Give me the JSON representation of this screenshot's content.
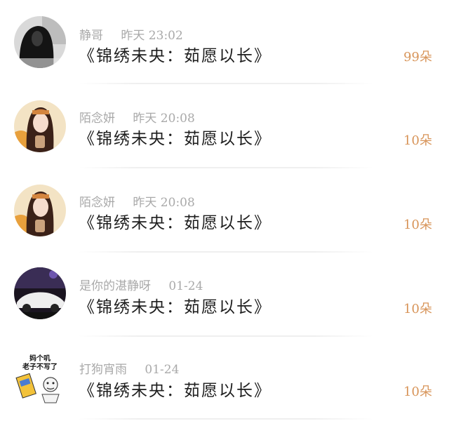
{
  "comments": [
    {
      "name": "静哥",
      "time": "昨天 23:02",
      "title": "《锦绣未央：茹愿以长》",
      "count": "99朵",
      "avatar": "dark-portrait-avatar"
    },
    {
      "name": "陌念妍",
      "time": "昨天 20:08",
      "title": "《锦绣未央：茹愿以长》",
      "count": "10朵",
      "avatar": "cartoon-girl-avatar"
    },
    {
      "name": "陌念妍",
      "time": "昨天 20:08",
      "title": "《锦绣未央：茹愿以长》",
      "count": "10朵",
      "avatar": "cartoon-girl-avatar"
    },
    {
      "name": "是你的湛静呀",
      "time": "01-24",
      "title": "《锦绣未央：茹愿以长》",
      "count": "10朵",
      "avatar": "white-sports-car-avatar"
    },
    {
      "name": "打狗宵雨",
      "time": "01-24",
      "title": "《锦绣未央：茹愿以长》",
      "count": "10朵",
      "avatar": "meme-sticker-avatar"
    }
  ],
  "sticker_text": {
    "line1": "妈个叽",
    "line2": "老子不写了"
  },
  "colors": {
    "count": "#d8955a",
    "meta": "#a9a9a9",
    "title": "#1e1e1e"
  }
}
